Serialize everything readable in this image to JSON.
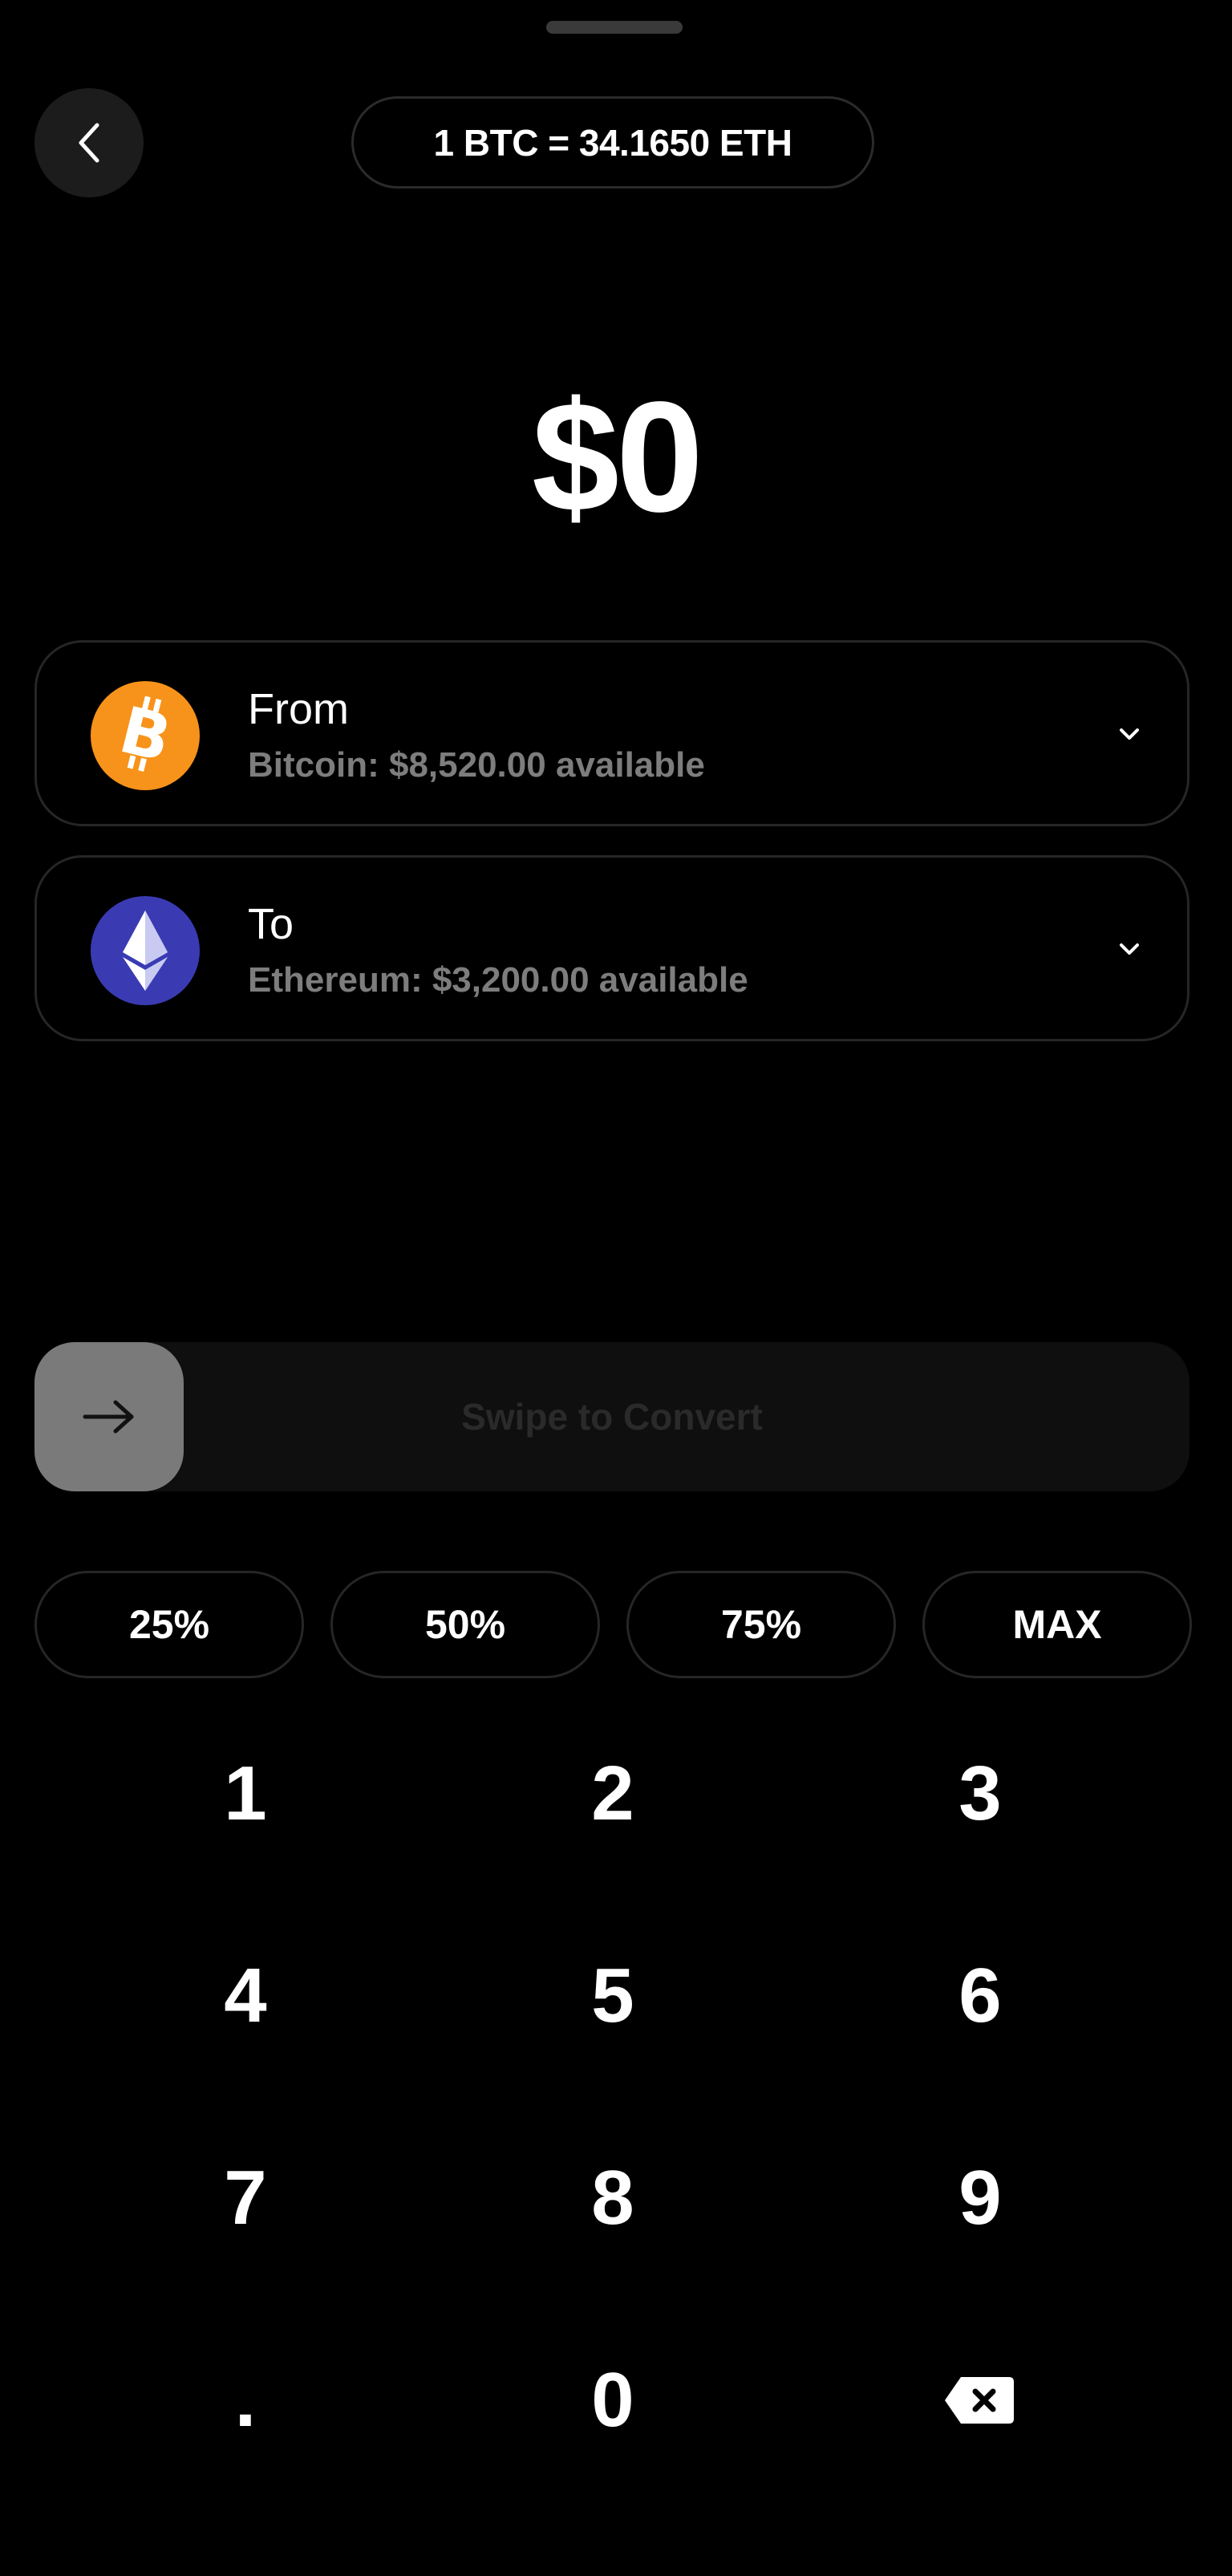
{
  "header": {
    "back_icon": "chevron-left-icon",
    "exchange_rate": "1 BTC = 34.1650 ETH"
  },
  "amount": {
    "display": "$0"
  },
  "from_card": {
    "title": "From",
    "subtitle": "Bitcoin: $8,520.00 available",
    "coin_icon": "bitcoin-icon",
    "coin_color": "#f7931a"
  },
  "to_card": {
    "title": "To",
    "subtitle": "Ethereum: $3,200.00 available",
    "coin_icon": "ethereum-icon",
    "coin_color": "#3a3bb3"
  },
  "swipe": {
    "label": "Swipe to Convert",
    "handle_icon": "arrow-right-icon"
  },
  "quick_amounts": [
    "25%",
    "50%",
    "75%",
    "MAX"
  ],
  "keypad": {
    "keys": [
      "1",
      "2",
      "3",
      "4",
      "5",
      "6",
      "7",
      "8",
      "9",
      ".",
      "0"
    ],
    "backspace_icon": "backspace-icon"
  }
}
